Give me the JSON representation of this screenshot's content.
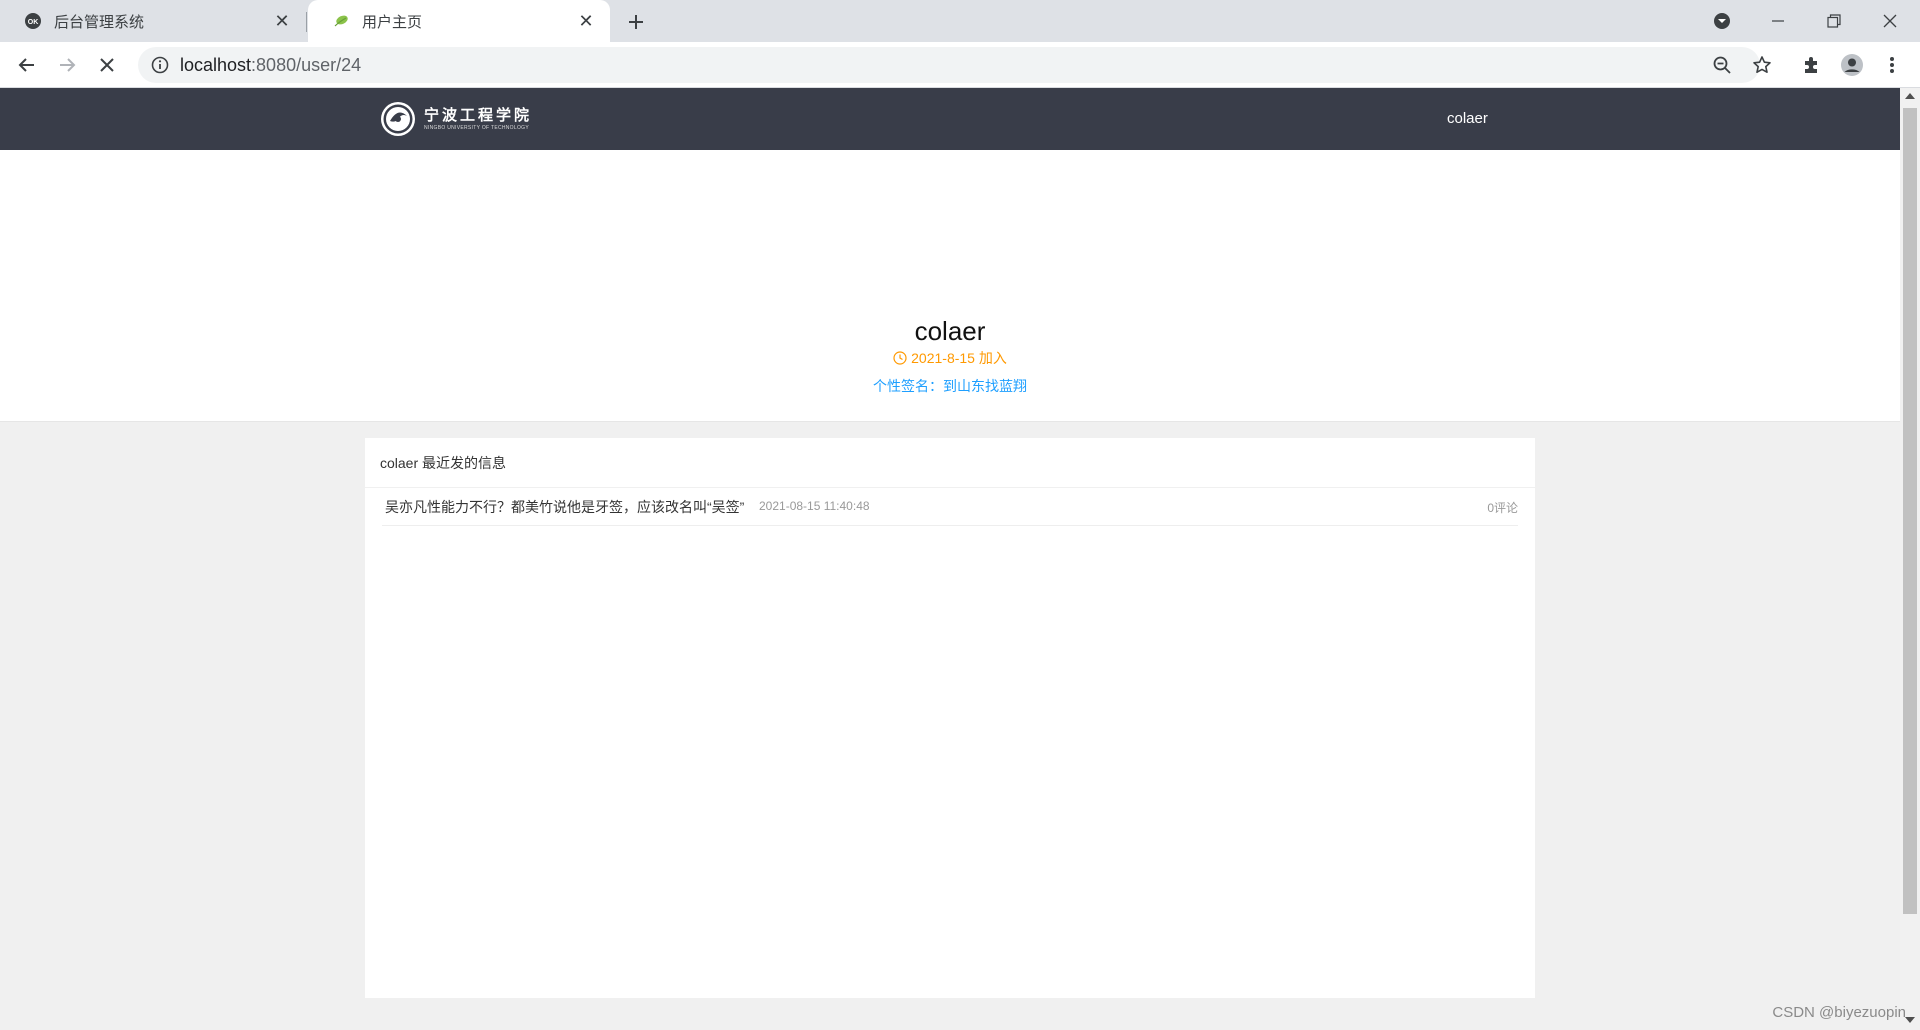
{
  "browser": {
    "tabs": [
      {
        "title": "后台管理系统",
        "active": false,
        "favicon": "ok-circle-icon"
      },
      {
        "title": "用户主页",
        "active": true,
        "favicon": "leaf-icon"
      }
    ],
    "url_host": "localhost",
    "url_rest": ":8080/user/24"
  },
  "site": {
    "logo_cn": "宁波工程学院",
    "logo_en": "NINGBO UNIVERSITY OF TECHNOLOGY",
    "nav_user": "colaer"
  },
  "profile": {
    "username": "colaer",
    "joined": "2021-8-15 加入",
    "signature": "个性签名：到山东找蓝翔"
  },
  "posts_section": {
    "title": "colaer 最近发的信息",
    "posts": [
      {
        "title": "吴亦凡性能力不行？都美竹说他是牙签，应该改名叫“吴签”",
        "time": "2021-08-15 11:40:48",
        "comments": "0评论"
      }
    ]
  },
  "watermark": "CSDN @biyezuopin",
  "colors": {
    "navbar": "#393d49",
    "joined": "#ff9900",
    "signature": "#1e9fff"
  }
}
